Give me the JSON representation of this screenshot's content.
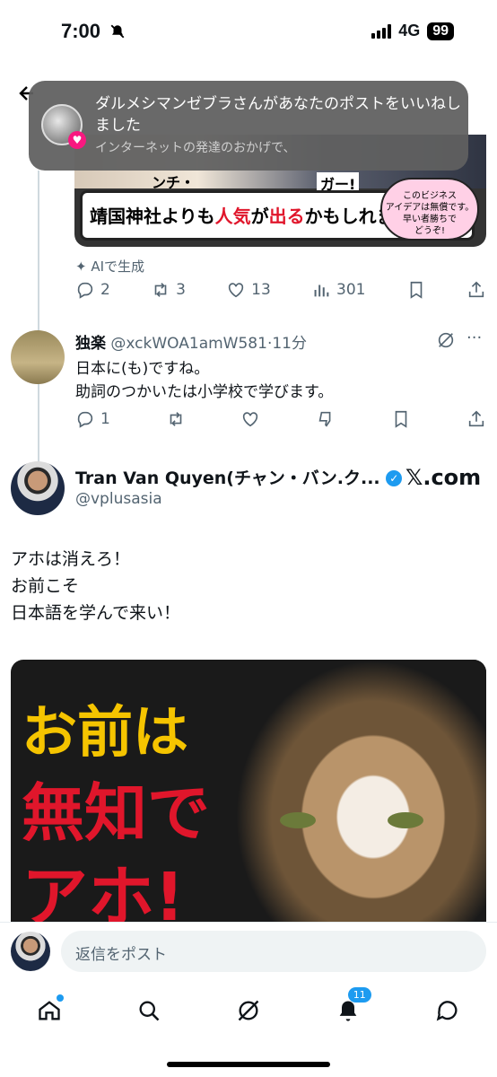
{
  "status_bar": {
    "time": "7:00",
    "network": "4G",
    "battery": "99"
  },
  "notification": {
    "title": "ダルメシマンゼブラさんがあなたのポストをいいねしました",
    "subtitle": "インターネットの発達のおかげで、"
  },
  "quoted_image": {
    "top_text_left": "ンチ・",
    "top_text_right": "ガー!",
    "banner": {
      "part1": "靖国神社よりも",
      "highlight1": "人気",
      "part2": "が",
      "highlight2": "出る",
      "part3": "かもしれません。"
    },
    "bubble_lines": [
      "このビジネス",
      "アイデアは無償です。",
      "早い者勝ちで",
      "どうぞ!"
    ]
  },
  "post1": {
    "ai_label": "AIで生成",
    "replies": "2",
    "reposts": "3",
    "likes": "13",
    "views": "301"
  },
  "reply": {
    "name": "独楽",
    "handle": "@xckWOA1amW581",
    "sep": "·",
    "time": "11分",
    "lines": [
      "日本に(も)ですね。",
      "助詞のつかいたは小学校で学びます。"
    ],
    "replies": "1"
  },
  "main_post": {
    "name": "Tran Van Quyen(チャン・バン.ク...",
    "handle": "@vplusasia",
    "xcom": "𝕏.com",
    "lines": [
      "アホは消えろ！",
      "お前こそ",
      "日本語を学んで来い！"
    ],
    "image_text": [
      "お前は",
      "無知で",
      "アホ!"
    ]
  },
  "reply_box": {
    "placeholder": "返信をポスト"
  },
  "tabbar": {
    "notifications_badge": "11"
  },
  "colors": {
    "accent": "#1d9bf0",
    "muted": "#536471",
    "like": "#f91880"
  }
}
